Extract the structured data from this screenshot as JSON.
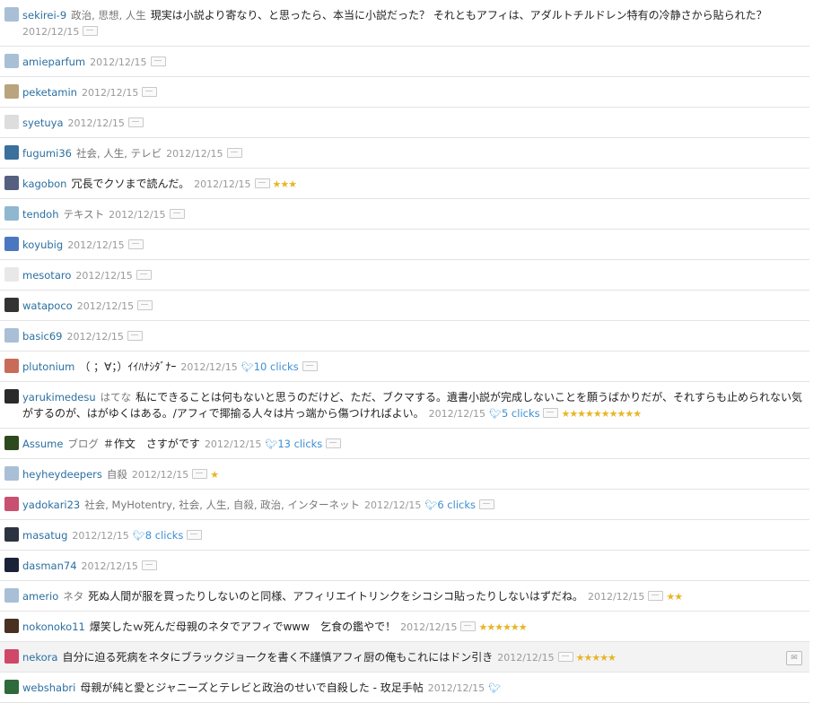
{
  "colors": {
    "user_link": "#2b6fa0",
    "star": "#e8b526",
    "twitter": "#4ea6d8",
    "row_highlight": "#f3f3f3"
  },
  "icons": {
    "bookmark": "bookmark-icon",
    "star": "star-icon",
    "twitter": "twitter-bird-icon",
    "comment_toggle": "comment-toggle-icon"
  },
  "entries": [
    {
      "user": "sekirei-9",
      "tags": "政治, 思想, 人生",
      "comment": "現実は小説より寄なり、と思ったら、本当に小説だった？ それともアフィは、アダルトチルドレン特有の冷静さから貼られた？",
      "date": "2012/12/15",
      "stars": "",
      "tw": false,
      "clicks": "",
      "hl": false,
      "avatar": "#a8bfd6"
    },
    {
      "user": "amieparfum",
      "tags": "",
      "comment": "",
      "date": "2012/12/15",
      "stars": "",
      "tw": false,
      "clicks": "",
      "hl": false,
      "avatar": "#a8bfd6"
    },
    {
      "user": "peketamin",
      "tags": "",
      "comment": "",
      "date": "2012/12/15",
      "stars": "",
      "tw": false,
      "clicks": "",
      "hl": false,
      "avatar": "#b9a47e"
    },
    {
      "user": "syetuya",
      "tags": "",
      "comment": "",
      "date": "2012/12/15",
      "stars": "",
      "tw": false,
      "clicks": "",
      "hl": false,
      "avatar": "#dddddd"
    },
    {
      "user": "fugumi36",
      "tags": "社会, 人生, テレビ",
      "comment": "",
      "date": "2012/12/15",
      "stars": "",
      "tw": false,
      "clicks": "",
      "hl": false,
      "avatar": "#3b6f9c"
    },
    {
      "user": "kagobon",
      "tags": "",
      "comment": "冗長でクソまで読んだ。",
      "date": "2012/12/15",
      "stars": "★★★",
      "tw": false,
      "clicks": "",
      "hl": false,
      "avatar": "#556080"
    },
    {
      "user": "tendoh",
      "tags": "テキスト",
      "comment": "",
      "date": "2012/12/15",
      "stars": "",
      "tw": false,
      "clicks": "",
      "hl": false,
      "avatar": "#8fb8d0"
    },
    {
      "user": "koyubig",
      "tags": "",
      "comment": "",
      "date": "2012/12/15",
      "stars": "",
      "tw": false,
      "clicks": "",
      "hl": false,
      "avatar": "#4a78c0"
    },
    {
      "user": "mesotaro",
      "tags": "",
      "comment": "",
      "date": "2012/12/15",
      "stars": "",
      "tw": false,
      "clicks": "",
      "hl": false,
      "avatar": "#e8e8e8"
    },
    {
      "user": "watapoco",
      "tags": "",
      "comment": "",
      "date": "2012/12/15",
      "stars": "",
      "tw": false,
      "clicks": "",
      "hl": false,
      "avatar": "#333333"
    },
    {
      "user": "basic69",
      "tags": "",
      "comment": "",
      "date": "2012/12/15",
      "stars": "",
      "tw": false,
      "clicks": "",
      "hl": false,
      "avatar": "#a8bfd6"
    },
    {
      "user": "plutonium",
      "tags": "",
      "comment": "（ ；∀；）ｲｲﾊﾅｼﾀﾞﾅｰ",
      "date": "2012/12/15",
      "stars": "",
      "tw": true,
      "clicks": "10 clicks",
      "hl": false,
      "avatar": "#c86c5a"
    },
    {
      "user": "yarukimedesu",
      "tags": "はてな",
      "comment": "私にできることは何もないと思うのだけど、ただ、ブクマする。遺書小説が完成しないことを願うばかりだが、それすらも止められない気がするのが、はがゆくはある。/アフィで揶揄る人々は片っ端から傷つければよい。",
      "date": "2012/12/15",
      "stars": "★★★★★★★★★★",
      "tw": true,
      "clicks": "5 clicks",
      "hl": false,
      "avatar": "#2a2a2a"
    },
    {
      "user": "Assume",
      "tags": "ブログ",
      "comment": "＃作文　さすがです",
      "date": "2012/12/15",
      "stars": "",
      "tw": true,
      "clicks": "13 clicks",
      "hl": false,
      "avatar": "#2d4a1e"
    },
    {
      "user": "heyheydeepers",
      "tags": "自殺",
      "comment": "",
      "date": "2012/12/15",
      "stars": "★",
      "tw": false,
      "clicks": "",
      "hl": false,
      "avatar": "#a8bfd6"
    },
    {
      "user": "yadokari23",
      "tags": "社会, MyHotentry, 社会, 人生, 自殺, 政治, インターネット",
      "comment": "",
      "date": "2012/12/15",
      "stars": "",
      "tw": true,
      "clicks": "6 clicks",
      "hl": false,
      "avatar": "#c85070"
    },
    {
      "user": "masatug",
      "tags": "",
      "comment": "",
      "date": "2012/12/15",
      "stars": "",
      "tw": true,
      "clicks": "8 clicks",
      "hl": false,
      "avatar": "#2c3340"
    },
    {
      "user": "dasman74",
      "tags": "",
      "comment": "",
      "date": "2012/12/15",
      "stars": "",
      "tw": false,
      "clicks": "",
      "hl": false,
      "avatar": "#1a2238"
    },
    {
      "user": "amerio",
      "tags": "ネタ",
      "comment": "死ぬ人間が服を買ったりしないのと同様、アフィリエイトリンクをシコシコ貼ったりしないはずだね。",
      "date": "2012/12/15",
      "stars": "★★",
      "tw": false,
      "clicks": "",
      "hl": false,
      "avatar": "#a8bfd6"
    },
    {
      "user": "nokonoko11",
      "tags": "",
      "comment": "爆笑したｗ死んだ母親のネタでアフィでwww　乞食の鑑やで！",
      "date": "2012/12/15",
      "stars": "★★★★★★",
      "tw": false,
      "clicks": "",
      "hl": false,
      "avatar": "#4a3020"
    },
    {
      "user": "nekora",
      "tags": "",
      "comment": "自分に迫る死病をネタにブラックジョークを書く不謹慎アフィ厨の俺もこれにはドン引き",
      "date": "2012/12/15",
      "stars": "★★★★★",
      "tw": false,
      "clicks": "",
      "hl": true,
      "avatar": "#d04868"
    },
    {
      "user": "webshabri",
      "tags": "",
      "comment": "母親が純と愛とジャニーズとテレビと政治のせいで自殺した - 玫足手帖",
      "date": "2012/12/15",
      "stars": "",
      "tw": true,
      "clicks": "",
      "hl": false,
      "avatar": "#2e6a3a"
    }
  ]
}
